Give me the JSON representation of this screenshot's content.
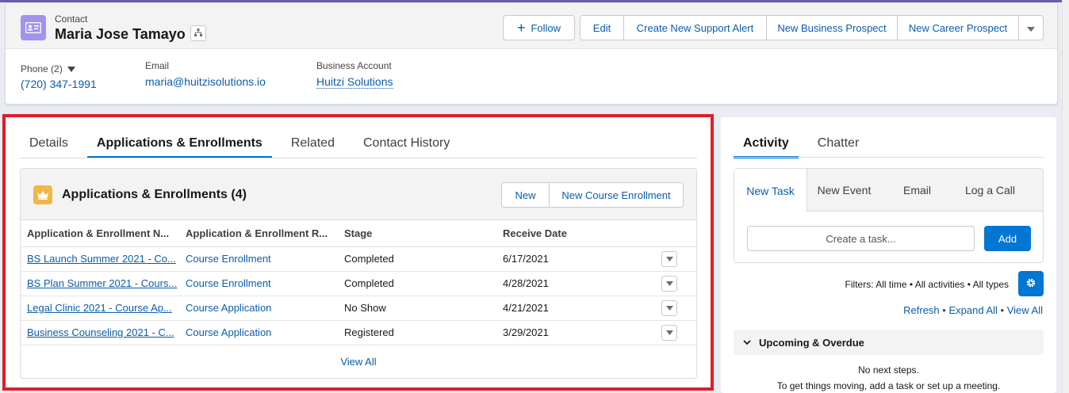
{
  "header": {
    "object_label": "Contact",
    "record_name": "Maria Jose Tamayo",
    "actions": {
      "follow": "Follow",
      "edit": "Edit",
      "create_support_alert": "Create New Support Alert",
      "new_business_prospect": "New Business Prospect",
      "new_career_prospect": "New Career Prospect"
    },
    "fields": {
      "phone_label": "Phone (2)",
      "phone_value": "(720) 347-1991",
      "email_label": "Email",
      "email_value": "maria@huitzisolutions.io",
      "account_label": "Business Account",
      "account_value": "Huitzi Solutions"
    }
  },
  "main_tabs": [
    "Details",
    "Applications & Enrollments",
    "Related",
    "Contact History"
  ],
  "related_list": {
    "title": "Applications & Enrollments (4)",
    "new_label": "New",
    "new_course_label": "New Course Enrollment",
    "columns": [
      "Application & Enrollment N...",
      "Application & Enrollment R...",
      "Stage",
      "Receive Date"
    ],
    "rows": [
      {
        "name": "BS Launch Summer 2021 - Co...",
        "record_type": "Course Enrollment",
        "stage": "Completed",
        "date": "6/17/2021"
      },
      {
        "name": "BS Plan Summer 2021 - Cours...",
        "record_type": "Course Enrollment",
        "stage": "Completed",
        "date": "4/28/2021"
      },
      {
        "name": "Legal Clinic 2021 - Course Ap...",
        "record_type": "Course Application",
        "stage": "No Show",
        "date": "4/21/2021"
      },
      {
        "name": "Business Counseling 2021 - C...",
        "record_type": "Course Application",
        "stage": "Registered",
        "date": "3/29/2021"
      }
    ],
    "view_all": "View All"
  },
  "activity": {
    "tabs": [
      "Activity",
      "Chatter"
    ],
    "composer_tabs": [
      "New Task",
      "New Event",
      "Email",
      "Log a Call"
    ],
    "task_placeholder": "Create a task...",
    "add_label": "Add",
    "filters_text": "Filters: All time • All activities • All types",
    "refresh": "Refresh",
    "expand_all": "Expand All",
    "view_all": "View All",
    "upcoming_label": "Upcoming & Overdue",
    "empty_line1": "No next steps.",
    "empty_line2": "To get things moving, add a task or set up a meeting."
  },
  "colors": {
    "brand_blue": "#0176d3",
    "link_blue": "#0b5cab",
    "highlight_red": "#e01e28",
    "contact_icon": "#a094ed",
    "crown_icon": "#f0b64a"
  },
  "icons": [
    "contact-card-icon",
    "hierarchy-icon",
    "plus-icon",
    "chevron-down-icon",
    "crown-icon",
    "gear-icon"
  ]
}
